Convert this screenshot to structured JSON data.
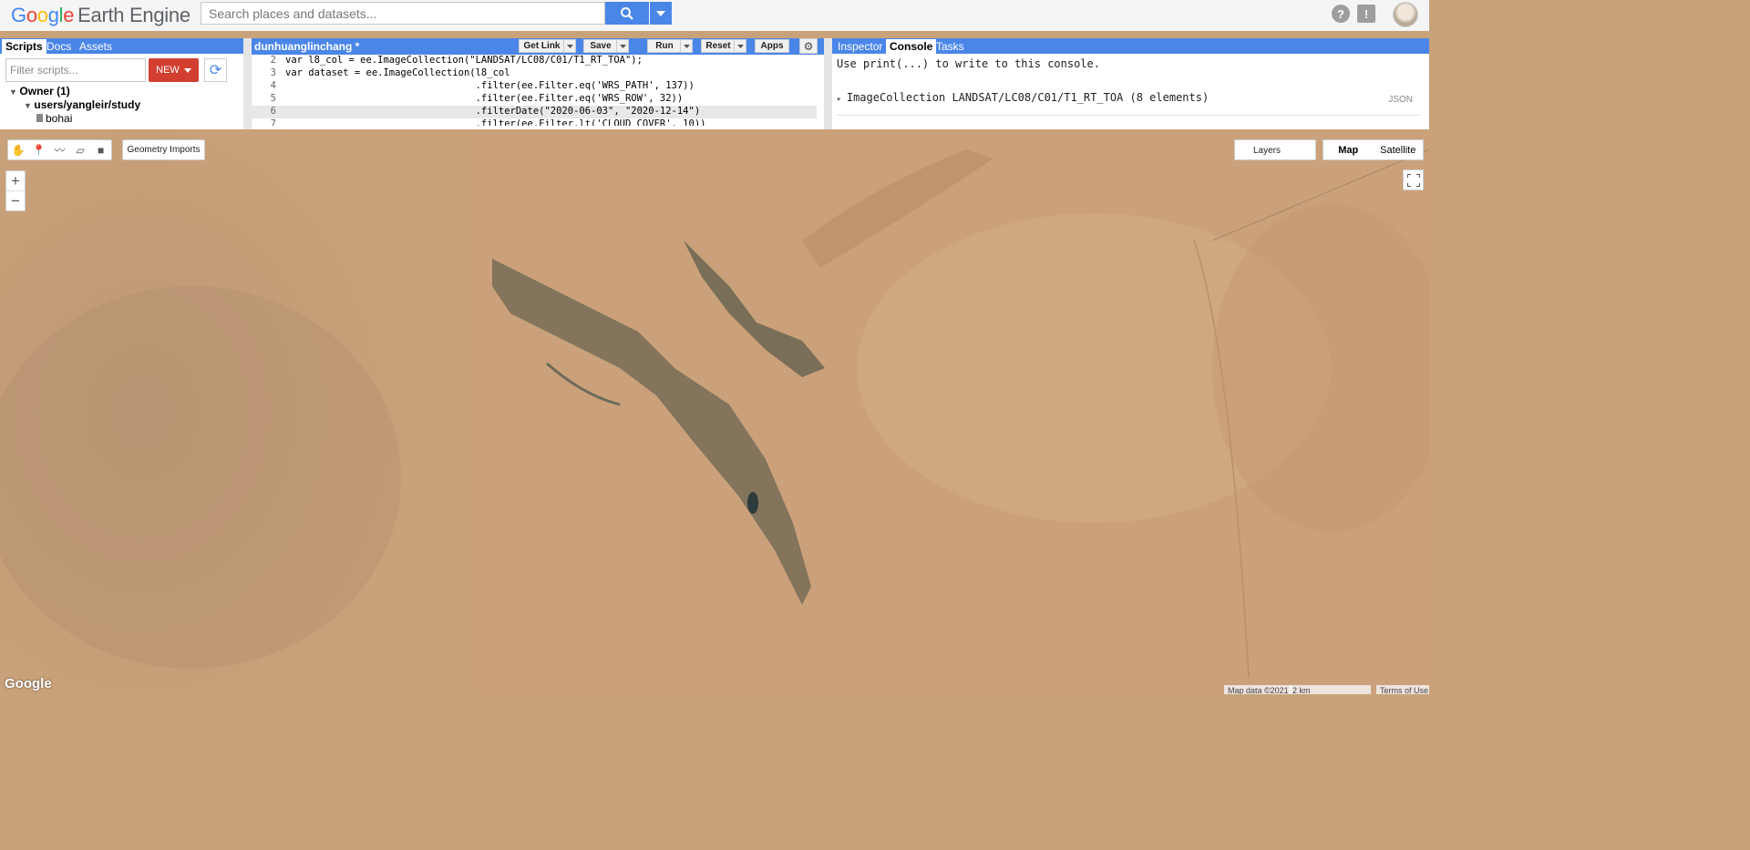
{
  "header": {
    "logo_google": [
      "G",
      "o",
      "o",
      "g",
      "l",
      "e"
    ],
    "logo_product": "Earth Engine",
    "search_placeholder": "Search places and datasets..."
  },
  "scripts_panel": {
    "tabs": [
      "Scripts",
      "Docs",
      "Assets"
    ],
    "filter_placeholder": "Filter scripts...",
    "new_label": "NEW",
    "tree": [
      {
        "label": "Owner  (1)",
        "indent": 0,
        "icon": "triangle-down"
      },
      {
        "label": "users/yangleir/study",
        "indent": 1,
        "icon": "triangle-down"
      },
      {
        "label": "bohai",
        "indent": 2,
        "icon": "file"
      }
    ]
  },
  "editor": {
    "file_title": "dunhuanglinchang *",
    "buttons": {
      "get_link": "Get Link",
      "save": "Save",
      "run": "Run",
      "reset": "Reset",
      "apps": "Apps"
    },
    "lines": [
      {
        "n": "2",
        "text": "var l8_col = ee.ImageCollection(\"LANDSAT/LC08/C01/T1_RT_TOA\");"
      },
      {
        "n": "3",
        "text": "var dataset = ee.ImageCollection(l8_col"
      },
      {
        "n": "4",
        "text": "                                 .filter(ee.Filter.eq('WRS_PATH', 137))"
      },
      {
        "n": "5",
        "text": "                                 .filter(ee.Filter.eq('WRS_ROW', 32))"
      },
      {
        "n": "6",
        "text": "                                 .filterDate(\"2020-06-03\", \"2020-12-14\")"
      },
      {
        "n": "7",
        "text": "                                 .filter(ee.Filter.lt('CLOUD_COVER', 10))"
      }
    ]
  },
  "console_panel": {
    "tabs": [
      "Inspector",
      "Console",
      "Tasks"
    ],
    "hint": "Use print(...) to write to this console.",
    "item": "ImageCollection LANDSAT/LC08/C01/T1_RT_TOA (8 elements)",
    "json_label": "JSON"
  },
  "map": {
    "geometry_imports": "Geometry Imports",
    "zoom_in": "+",
    "zoom_out": "−",
    "layers": "Layers",
    "map_type": "Map",
    "satellite_type": "Satellite",
    "watermark": "Google",
    "attribution": "Map data ©2021",
    "scale": "2 km",
    "terms": "Terms of Use"
  },
  "colors": {
    "accent": "#4a86e8",
    "new_button": "#d23f31",
    "desert": "#c9a27a"
  }
}
